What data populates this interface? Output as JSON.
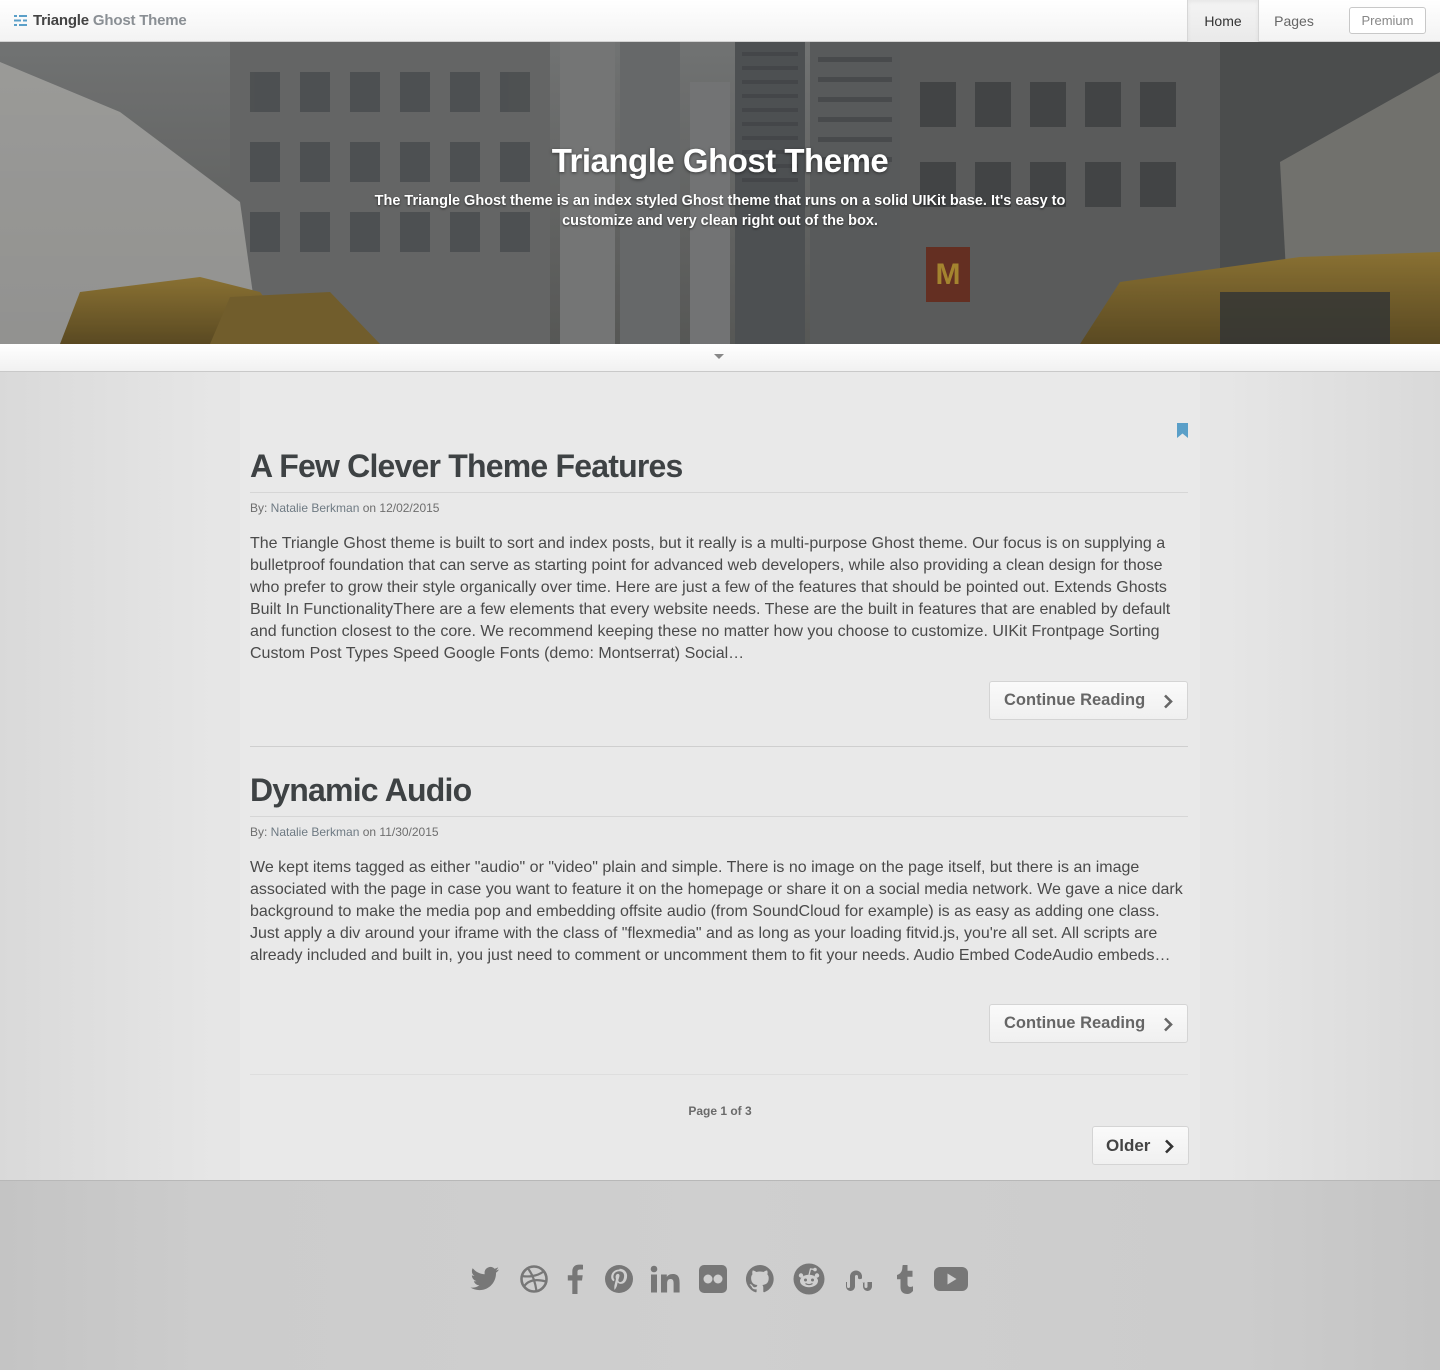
{
  "navbar": {
    "brand_part1": "Triangle",
    "brand_part2": "Ghost Theme",
    "brand_icon": "menu-lines-icon",
    "items": [
      {
        "label": "Home",
        "active": true
      },
      {
        "label": "Pages",
        "active": false
      }
    ],
    "premium_label": "Premium"
  },
  "hero": {
    "title": "Triangle Ghost Theme",
    "subtitle": "The Triangle Ghost theme is an index styled Ghost theme that runs on a solid UIKit base. It's easy to customize and very clean right out of the box."
  },
  "toggle": {
    "icon": "caret-down-icon"
  },
  "posts": [
    {
      "title": "A Few Clever Theme Features",
      "meta_prefix": "By: ",
      "author": "Natalie Berkman",
      "meta_on": " on ",
      "date": "12/02/2015",
      "excerpt": "The Triangle Ghost theme is built to sort and index posts, but it really is a multi-purpose Ghost theme. Our focus is on supplying a bulletproof foundation that can serve as starting point for advanced web developers, while also providing a clean design for those who prefer to grow their style organically over time. Here are just a few of the features that should be pointed out. Extends Ghosts Built In FunctionalityThere are a few elements that every website needs. These are the built in features that are enabled by default and function closest to the core. We recommend keeping these no matter how you choose to customize. UIKit Frontpage Sorting Custom Post Types Speed Google Fonts (demo: Montserrat) Social…",
      "button_label": "Continue Reading",
      "featured": true
    },
    {
      "title": "Dynamic Audio",
      "meta_prefix": "By: ",
      "author": "Natalie Berkman",
      "meta_on": " on ",
      "date": "11/30/2015",
      "excerpt": "We kept items tagged as either \"audio\" or \"video\" plain and simple. There is no image on the page itself, but there is an image associated with the page in case you want to feature it on the homepage or share it on a social media network. We gave a nice dark background to make the media pop and embedding offsite audio (from SoundCloud for example) is as easy as adding one class. Just apply a div around your iframe with the class of \"flexmedia\" and as long as your loading fitvid.js, you're all set. All scripts are already included and built in, you just need to comment or uncomment them to fit your needs. Audio Embed CodeAudio embeds…",
      "button_label": "Continue Reading",
      "featured": false
    }
  ],
  "pagination": {
    "page_info": "Page 1 of 3",
    "older_label": "Older"
  },
  "footer": {
    "social_icons": [
      "twitter-icon",
      "dribbble-icon",
      "facebook-icon",
      "pinterest-icon",
      "linkedin-icon",
      "flickr-icon",
      "github-icon",
      "reddit-icon",
      "stumbleupon-icon",
      "tumblr-icon",
      "youtube-icon"
    ],
    "icon_color": "#777777"
  },
  "colors": {
    "accent": "#5a9fc8",
    "title_text": "#3e4244",
    "body_background": "#e9e9e9"
  }
}
